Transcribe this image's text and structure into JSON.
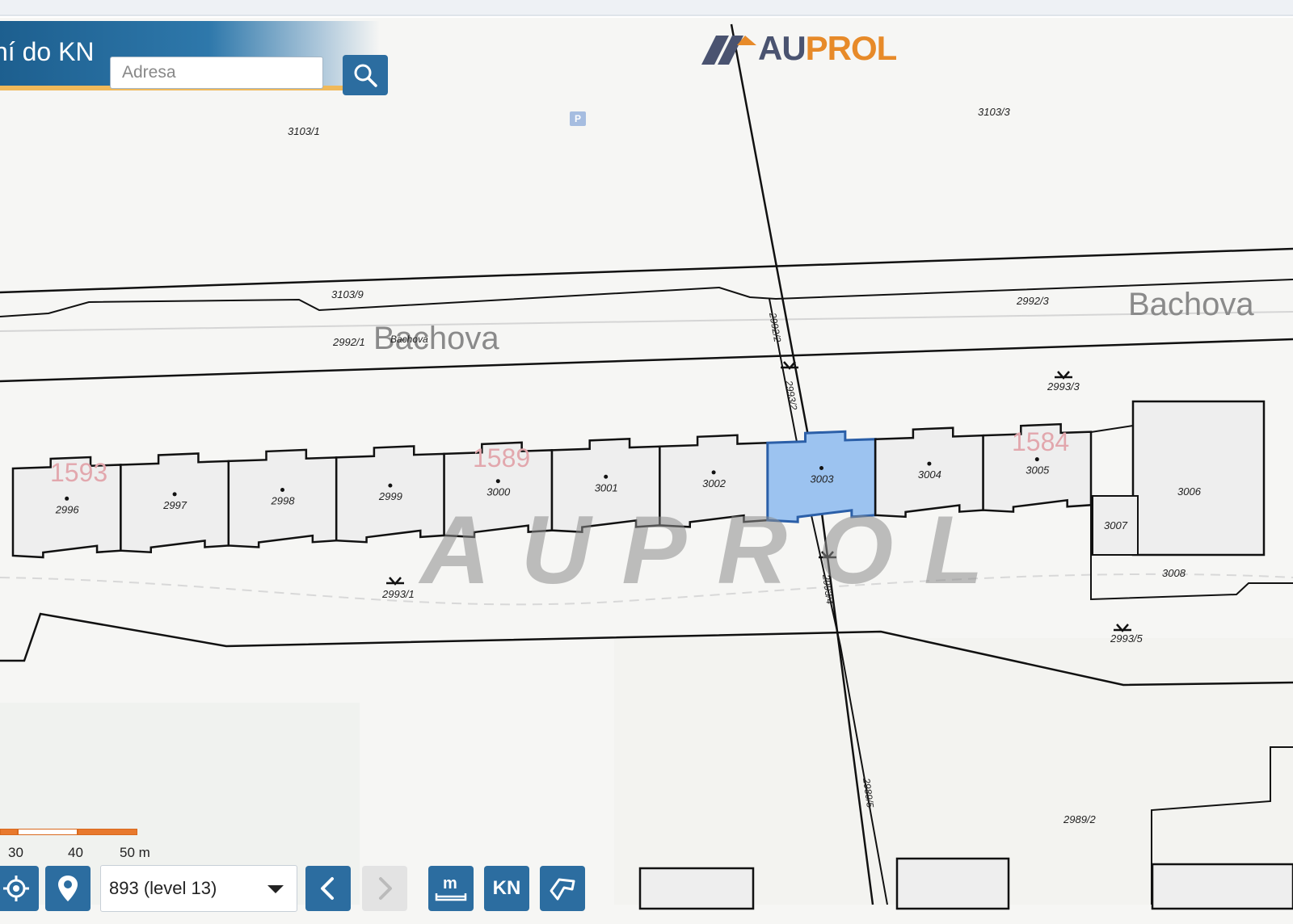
{
  "search": {
    "title": "ní do KN",
    "placeholder": "Adresa"
  },
  "logo": {
    "text_left": "AU",
    "text_right": "PROL"
  },
  "watermark": "AUPROL",
  "parking_label": "P",
  "streets": {
    "top_left": "Bachova",
    "top_right": "Bachova",
    "small": "Bachova"
  },
  "sheets": {
    "left": "1593",
    "middle": "1589",
    "right": "1584"
  },
  "parcels": {
    "p3103_1": "3103/1",
    "p3103_3": "3103/3",
    "p3103_9": "3103/9",
    "p2992_1": "2992/1",
    "p2992_3": "2992/3",
    "p2993_1": "2993/1",
    "p2993_3": "2993/3",
    "p2993_5": "2993/5",
    "p2989_2": "2989/2",
    "p2992_2": "2992/2",
    "p2993_2": "2993/2",
    "p2993_4": "2993/4",
    "p2989_5": "2989/5",
    "buildings": [
      "2996",
      "2997",
      "2998",
      "2999",
      "3000",
      "3001",
      "3002",
      "3003",
      "3004",
      "3005"
    ],
    "b3006": "3006",
    "b3007": "3007",
    "b3008": "3008"
  },
  "selected_parcel": "3003",
  "scale": {
    "labels": [
      "30",
      "40",
      "50 m"
    ]
  },
  "toolbar": {
    "zoom_value": "893 (level 13)",
    "measure_icon": "m",
    "kn_label": "KN"
  },
  "colors": {
    "selected_fill": "#9cc3f0",
    "toolbar_blue": "#2c6da0",
    "accent_orange": "#e78a29"
  }
}
